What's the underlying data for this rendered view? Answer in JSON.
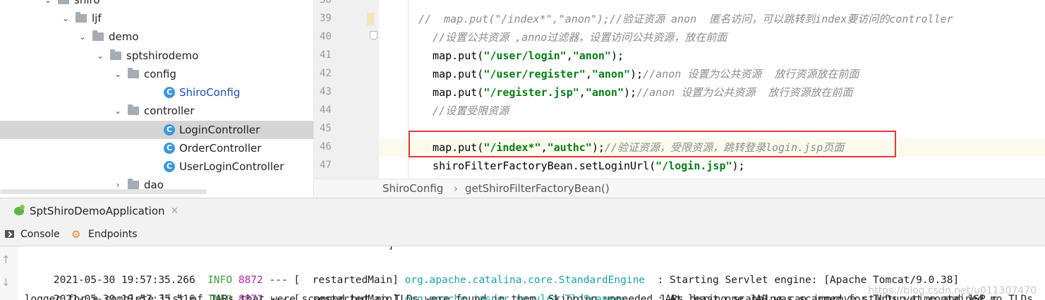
{
  "project_tree": {
    "items": [
      {
        "label": "shiro",
        "kind": "folder"
      },
      {
        "label": "ljf",
        "kind": "folder"
      },
      {
        "label": "demo",
        "kind": "folder"
      },
      {
        "label": "sptshirodemo",
        "kind": "folder"
      },
      {
        "label": "config",
        "kind": "folder"
      },
      {
        "label": "ShiroConfig",
        "kind": "class"
      },
      {
        "label": "controller",
        "kind": "folder"
      },
      {
        "label": "LoginController",
        "kind": "class",
        "selected": true
      },
      {
        "label": "OrderController",
        "kind": "class"
      },
      {
        "label": "UserLoginController",
        "kind": "class"
      },
      {
        "label": "dao",
        "kind": "folder",
        "collapsed": true
      }
    ],
    "class_icon_letter": "C"
  },
  "editor": {
    "line_numbers": [
      "38",
      "39",
      "40",
      "41",
      "42",
      "43",
      "44",
      "45",
      "46",
      "47"
    ],
    "lines": [
      {
        "parts": []
      },
      {
        "parts": [
          {
            "t": "//  map.put(\"/index*\",\"anon\");//验证资源 anon  匿名访问，可以跳转到index要访问的controller",
            "c": "cmt"
          }
        ]
      },
      {
        "parts": [
          {
            "t": "  //设置公共资源 ,anno过滤器，设置访问公共资源，放在前面",
            "c": "cmt"
          }
        ]
      },
      {
        "parts": [
          {
            "t": "  map.put(",
            "c": ""
          },
          {
            "t": "\"/user/login\"",
            "c": "str"
          },
          {
            "t": ",",
            "c": ""
          },
          {
            "t": "\"anon\"",
            "c": "str"
          },
          {
            "t": ");",
            "c": ""
          }
        ]
      },
      {
        "parts": [
          {
            "t": "  map.put(",
            "c": ""
          },
          {
            "t": "\"/user/register\"",
            "c": "str"
          },
          {
            "t": ",",
            "c": ""
          },
          {
            "t": "\"anon\"",
            "c": "str"
          },
          {
            "t": ");",
            "c": ""
          },
          {
            "t": "//anon 设置为公共资源  放行资源放在前面",
            "c": "cmt"
          }
        ]
      },
      {
        "parts": [
          {
            "t": "  map.put(",
            "c": ""
          },
          {
            "t": "\"/register.jsp\"",
            "c": "str"
          },
          {
            "t": ",",
            "c": ""
          },
          {
            "t": "\"anon\"",
            "c": "str"
          },
          {
            "t": ");",
            "c": ""
          },
          {
            "t": "//anon 设置为公共资源  放行资源放在前面",
            "c": "cmt"
          }
        ]
      },
      {
        "parts": [
          {
            "t": "  //设置受限资源",
            "c": "cmt"
          }
        ]
      },
      {
        "parts": []
      },
      {
        "parts": [
          {
            "t": "  map.put(",
            "c": ""
          },
          {
            "t": "\"/index*\"",
            "c": "str"
          },
          {
            "t": ",",
            "c": ""
          },
          {
            "t": "\"authc\"",
            "c": "str"
          },
          {
            "t": ");",
            "c": ""
          },
          {
            "t": "//验证资源，受限资源，跳转登录login.jsp页面",
            "c": "cmt"
          }
        ]
      },
      {
        "parts": [
          {
            "t": "  shiroFilterFactoryBean.setLoginUrl(",
            "c": ""
          },
          {
            "t": "\"/login.jsp\"",
            "c": "str"
          },
          {
            "t": ");",
            "c": ""
          }
        ]
      }
    ]
  },
  "breadcrumb": {
    "items": [
      "ShiroConfig",
      "getShiroFilterFactoryBean()"
    ],
    "separator": "›"
  },
  "run_panel": {
    "title": "SptShiroDemoApplication",
    "close": "×",
    "tabs": [
      "Console",
      "Endpoints"
    ]
  },
  "console": {
    "top_partial": "                                                            ]                                                                            ",
    "lines": [
      {
        "ts": "2021-05-30 19:57:35.266",
        "level": "INFO",
        "pid": "8872",
        "sep": " --- [  restartedMain] ",
        "cls": "org.apache.catalina.core.StandardEngine",
        "msg": "  : Starting Servlet engine: [Apache Tomcat/9.0.38]"
      },
      {
        "ts": "2021-05-30 19:57:35.516",
        "level": "INFO",
        "pid": "8872",
        "sep": " --- [  restartedMain] ",
        "cls": "org.apache.jasper.servlet.TldScanner",
        "msg": "     : At least one JAR was scanned for TLDs yet contained no TLDs."
      }
    ],
    "bottom_partial": " logger for a complete list of JARs that were scanned but no TLDs were found in them. Skipping unneeded JARs during scanning can improve startup time and JSP c",
    "watermark": "https://blog.csdn.net/u011307470"
  },
  "colors": {
    "string": "#067d17",
    "comment": "#8c8c8c",
    "log_level": "#3c9c3c",
    "log_pid": "#b02aa0",
    "log_class": "#1fa3a3",
    "highlight_box": "#e53935"
  }
}
